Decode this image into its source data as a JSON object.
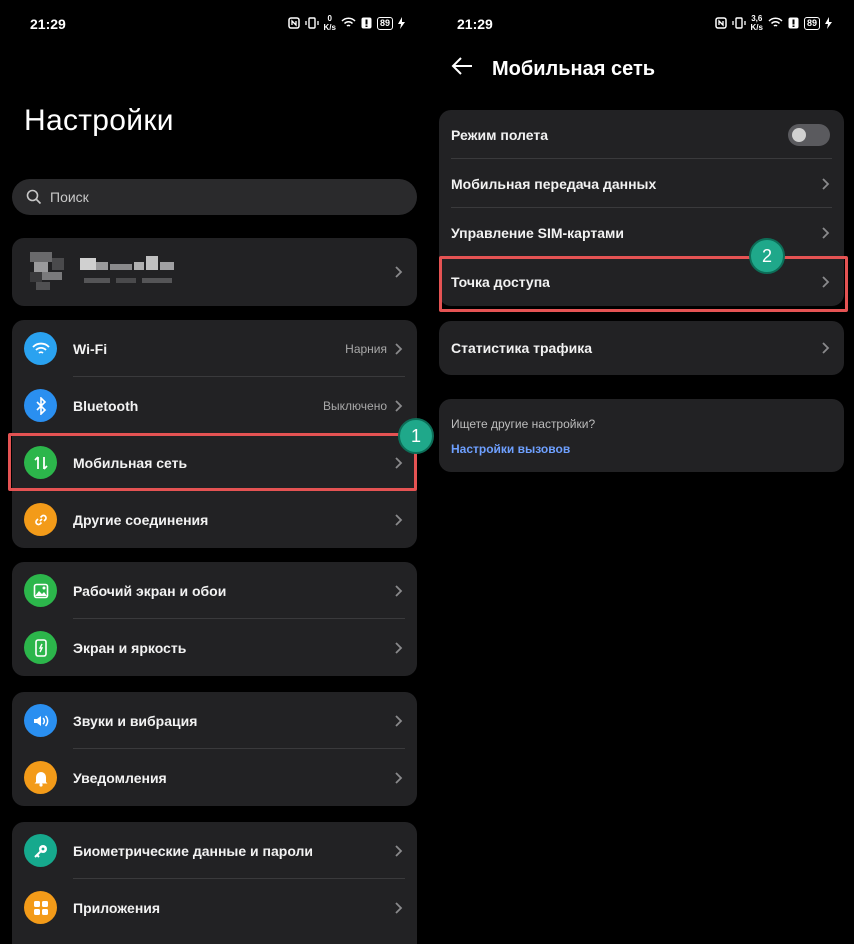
{
  "left": {
    "status": {
      "time": "21:29",
      "net_top": "0",
      "net_bottom": "K/s",
      "battery": "89"
    },
    "title": "Настройки",
    "search": {
      "placeholder": "Поиск"
    },
    "connectivity": [
      {
        "label": "Wi-Fi",
        "value": "Нарния",
        "icon": "wifi-icon",
        "color": "#2aa2f0"
      },
      {
        "label": "Bluetooth",
        "value": "Выключено",
        "icon": "bluetooth-icon",
        "color": "#2a8ff0"
      },
      {
        "label": "Мобильная сеть",
        "value": "",
        "icon": "mobile-data-icon",
        "color": "#2cb64b"
      },
      {
        "label": "Другие соединения",
        "value": "",
        "icon": "link-icon",
        "color": "#f39b19"
      }
    ],
    "display": [
      {
        "label": "Рабочий экран и обои",
        "icon": "wallpaper-icon",
        "color": "#2cb64b"
      },
      {
        "label": "Экран и яркость",
        "icon": "brightness-icon",
        "color": "#2cb64b"
      }
    ],
    "sound": [
      {
        "label": "Звуки и вибрация",
        "icon": "volume-icon",
        "color": "#2a8ff0"
      },
      {
        "label": "Уведомления",
        "icon": "bell-icon",
        "color": "#f39b19"
      }
    ],
    "security": [
      {
        "label": "Биометрические данные и пароли",
        "icon": "key-icon",
        "color": "#16a98d"
      },
      {
        "label": "Приложения",
        "icon": "apps-icon",
        "color": "#f39b19"
      }
    ],
    "badge": "1"
  },
  "right": {
    "status": {
      "time": "21:29",
      "net_top": "3,6",
      "net_bottom": "K/s",
      "battery": "89"
    },
    "title": "Мобильная сеть",
    "items": [
      {
        "label": "Режим полета"
      },
      {
        "label": "Мобильная передача данных"
      },
      {
        "label": "Управление SIM-картами"
      },
      {
        "label": "Точка доступа"
      }
    ],
    "traffic": "Статистика трафика",
    "other": {
      "question": "Ищете другие настройки?",
      "link": "Настройки вызовов"
    },
    "airplane_on": false,
    "badge": "2"
  },
  "colors": {
    "highlight": "#e55353",
    "badge": "#1fa88a",
    "link": "#6ea0ff"
  }
}
